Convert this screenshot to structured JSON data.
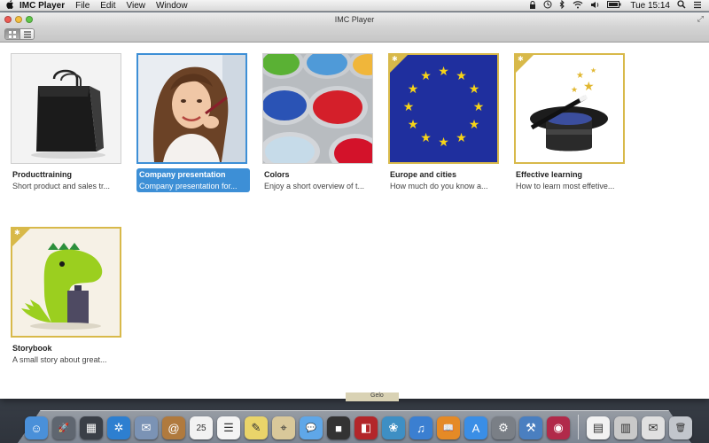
{
  "menubar": {
    "apple": "",
    "app_name": "IMC Player",
    "items": [
      "File",
      "Edit",
      "View",
      "Window"
    ],
    "clock": "Tue 15:14",
    "status_icons": [
      "lock-icon",
      "time-machine-icon",
      "bluetooth-icon",
      "wifi-icon",
      "volume-icon",
      "battery-icon",
      "search-icon",
      "list-icon"
    ]
  },
  "window": {
    "title": "IMC Player",
    "fullscreen_glyph": "⤢",
    "view_modes": [
      "grid",
      "list"
    ]
  },
  "tiles": [
    {
      "title": "Producttraining",
      "desc": "Short product and sales tr...",
      "selected": false,
      "badge": false,
      "image": "shopping-bag"
    },
    {
      "title": "Company presentation",
      "desc": "Company presentation for...",
      "selected": true,
      "badge": false,
      "image": "woman-portrait"
    },
    {
      "title": "Colors",
      "desc": "Enjoy a short overview of t...",
      "selected": false,
      "badge": false,
      "image": "paint-cans"
    },
    {
      "title": "Europe and cities",
      "desc": "How much do you know a...",
      "selected": false,
      "badge": true,
      "image": "eu-flag"
    },
    {
      "title": "Effective learning",
      "desc": "How to learn most effetive...",
      "selected": false,
      "badge": true,
      "image": "magic-hat"
    },
    {
      "title": "Storybook",
      "desc": "A small story about great...",
      "selected": false,
      "badge": true,
      "image": "green-dragon"
    }
  ],
  "dock": {
    "folder_label": "Gelo",
    "calendar_day": "25",
    "items": [
      {
        "name": "finder-icon",
        "glyph": "☺",
        "color": "#4a90d9"
      },
      {
        "name": "launchpad-icon",
        "glyph": "🚀",
        "color": "#5f6670"
      },
      {
        "name": "mission-control-icon",
        "glyph": "▦",
        "color": "#3a3f47"
      },
      {
        "name": "safari-icon",
        "glyph": "✲",
        "color": "#2d7fd0"
      },
      {
        "name": "mail-icon",
        "glyph": "✉",
        "color": "#7b93b5"
      },
      {
        "name": "contacts-icon",
        "glyph": "@",
        "color": "#b07a3e"
      },
      {
        "name": "calendar-icon",
        "glyph": "25",
        "color": "#f2f2f2"
      },
      {
        "name": "reminders-icon",
        "glyph": "☰",
        "color": "#f4f4f4"
      },
      {
        "name": "notes-icon",
        "glyph": "✎",
        "color": "#e9d46a"
      },
      {
        "name": "maps-icon",
        "glyph": "⌖",
        "color": "#d9c89a"
      },
      {
        "name": "messages-icon",
        "glyph": "💬",
        "color": "#5fa7e8"
      },
      {
        "name": "facetime-icon",
        "glyph": "■",
        "color": "#333333"
      },
      {
        "name": "photo-booth-icon",
        "glyph": "◧",
        "color": "#b3262a"
      },
      {
        "name": "iphoto-icon",
        "glyph": "❀",
        "color": "#3e8fc4"
      },
      {
        "name": "itunes-icon",
        "glyph": "♫",
        "color": "#3b7fd1"
      },
      {
        "name": "ibooks-icon",
        "glyph": "📖",
        "color": "#e58a26"
      },
      {
        "name": "app-store-icon",
        "glyph": "A",
        "color": "#3a8ee6"
      },
      {
        "name": "system-preferences-icon",
        "glyph": "⚙",
        "color": "#7a7f86"
      },
      {
        "name": "xcode-icon",
        "glyph": "⚒",
        "color": "#4a7fc0"
      },
      {
        "name": "imc-player-icon",
        "glyph": "◉",
        "color": "#b12a4a"
      }
    ],
    "right_items": [
      {
        "name": "document-icon",
        "glyph": "▤",
        "color": "#f2f2f2"
      },
      {
        "name": "downloads-stack-icon",
        "glyph": "▥",
        "color": "#c9c9c9"
      },
      {
        "name": "mail-stack-icon",
        "glyph": "✉",
        "color": "#e0e0e0"
      },
      {
        "name": "trash-icon",
        "glyph": "🗑",
        "color": "#c2c6cc"
      }
    ]
  }
}
